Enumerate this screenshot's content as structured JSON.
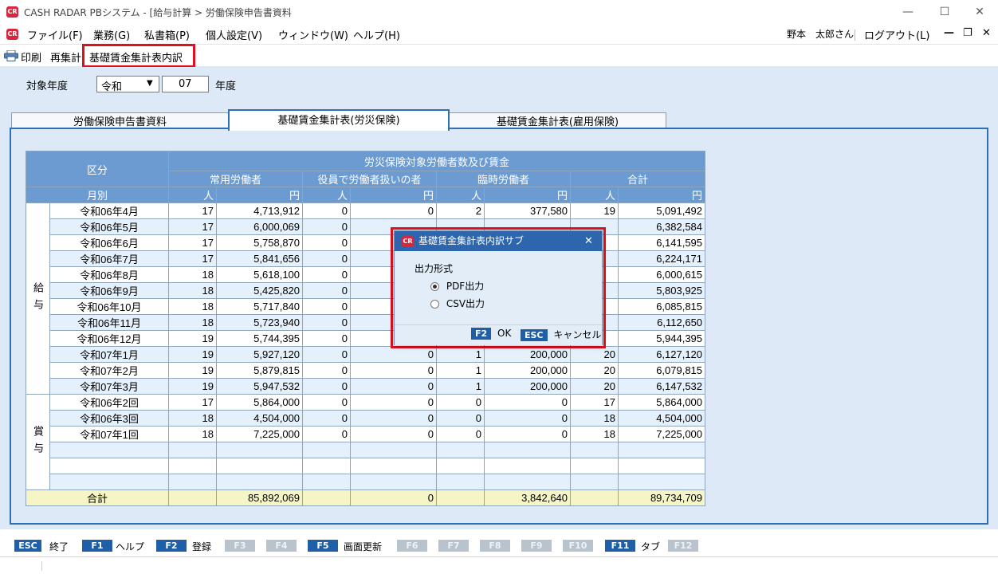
{
  "window": {
    "title": "CASH RADAR PBシステム - [給与計算 > 労働保険申告書資料",
    "icon_text": "CR",
    "minimize": "—",
    "maximize": "☐",
    "close": "✕"
  },
  "menubar": {
    "items": [
      "ファイル(F)",
      "業務(G)",
      "私書箱(P)",
      "個人設定(V)",
      "ウィンドウ(W)",
      "ヘルプ(H)"
    ],
    "user": "野本　太郎さん",
    "logout": "ログアウト(L)",
    "mdi_minimize": "—",
    "mdi_restore": "❐",
    "mdi_close": "✕"
  },
  "toolbar": {
    "print": "印刷",
    "recalc": "再集計",
    "breakdown": "基礎賃金集計表内訳"
  },
  "filter": {
    "label": "対象年度",
    "era": "令和",
    "year": "07",
    "suffix": "年度"
  },
  "tabs": [
    "労働保険申告書資料",
    "基礎賃金集計表(労災保険)",
    "基礎賃金集計表(雇用保険)"
  ],
  "table": {
    "h_kubun": "区分",
    "h_group": "労災保険対象労働者数及び賃金",
    "h_cols": [
      "常用労働者",
      "役員で労働者扱いの者",
      "臨時労働者",
      "合計"
    ],
    "h_month": "月別",
    "unit_person": "人",
    "unit_yen": "円",
    "salary_label": "給与",
    "bonus_label": "賞与",
    "salary_rows": [
      [
        "令和06年4月",
        "17",
        "4,713,912",
        "0",
        "0",
        "2",
        "377,580",
        "19",
        "5,091,492"
      ],
      [
        "令和06年5月",
        "17",
        "6,000,069",
        "0",
        "",
        "",
        "",
        "",
        "6,382,584"
      ],
      [
        "令和06年6月",
        "17",
        "5,758,870",
        "0",
        "",
        "",
        "",
        "",
        "6,141,595"
      ],
      [
        "令和06年7月",
        "17",
        "5,841,656",
        "0",
        "",
        "",
        "",
        "",
        "6,224,171"
      ],
      [
        "令和06年8月",
        "18",
        "5,618,100",
        "0",
        "",
        "",
        "",
        "",
        "6,000,615"
      ],
      [
        "令和06年9月",
        "18",
        "5,425,820",
        "0",
        "",
        "",
        "",
        "",
        "5,803,925"
      ],
      [
        "令和06年10月",
        "18",
        "5,717,840",
        "0",
        "",
        "",
        "",
        "",
        "6,085,815"
      ],
      [
        "令和06年11月",
        "18",
        "5,723,940",
        "0",
        "",
        "",
        "",
        "",
        "6,112,650"
      ],
      [
        "令和06年12月",
        "19",
        "5,744,395",
        "0",
        "",
        "",
        "",
        "",
        "5,944,395"
      ],
      [
        "令和07年1月",
        "19",
        "5,927,120",
        "0",
        "0",
        "1",
        "200,000",
        "20",
        "6,127,120"
      ],
      [
        "令和07年2月",
        "19",
        "5,879,815",
        "0",
        "0",
        "1",
        "200,000",
        "20",
        "6,079,815"
      ],
      [
        "令和07年3月",
        "19",
        "5,947,532",
        "0",
        "0",
        "1",
        "200,000",
        "20",
        "6,147,532"
      ]
    ],
    "bonus_rows": [
      [
        "令和06年2回",
        "17",
        "5,864,000",
        "0",
        "0",
        "0",
        "0",
        "17",
        "5,864,000"
      ],
      [
        "令和06年3回",
        "18",
        "4,504,000",
        "0",
        "0",
        "0",
        "0",
        "18",
        "4,504,000"
      ],
      [
        "令和07年1回",
        "18",
        "7,225,000",
        "0",
        "0",
        "0",
        "0",
        "18",
        "7,225,000"
      ]
    ],
    "total_label": "合計",
    "totals": [
      "",
      "85,892,069",
      "",
      "0",
      "",
      "3,842,640",
      "",
      "89,734,709"
    ]
  },
  "dialog": {
    "title": "基礎賃金集計表内訳サブ",
    "close": "✕",
    "group_label": "出力形式",
    "options": [
      "PDF出力",
      "CSV出力"
    ],
    "selected": 0,
    "ok_key": "F2",
    "ok_label": "OK",
    "cancel_key": "ESC",
    "cancel_label": "キャンセル"
  },
  "fkeys": [
    {
      "key": "ESC",
      "label": "終了",
      "enabled": true
    },
    {
      "key": "F1",
      "label": "ヘルプ",
      "enabled": true
    },
    {
      "key": "F2",
      "label": "登録",
      "enabled": true
    },
    {
      "key": "F3",
      "label": "",
      "enabled": false
    },
    {
      "key": "F4",
      "label": "",
      "enabled": false
    },
    {
      "key": "F5",
      "label": "画面更新",
      "enabled": true
    },
    {
      "key": "F6",
      "label": "",
      "enabled": false
    },
    {
      "key": "F7",
      "label": "",
      "enabled": false
    },
    {
      "key": "F8",
      "label": "",
      "enabled": false
    },
    {
      "key": "F9",
      "label": "",
      "enabled": false
    },
    {
      "key": "F10",
      "label": "",
      "enabled": false
    },
    {
      "key": "F11",
      "label": "タブ",
      "enabled": true
    },
    {
      "key": "F12",
      "label": "",
      "enabled": false
    }
  ],
  "colors": {
    "header_blue": "#6c9bd2",
    "panel_blue": "#dde9f7",
    "dialog_title": "#2d66ad",
    "highlight_red": "#e01020",
    "total_yellow": "#f5f5c6"
  }
}
